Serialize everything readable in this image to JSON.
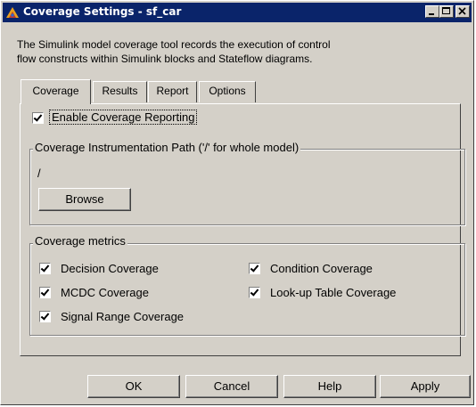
{
  "window": {
    "title": "Coverage Settings - sf_car"
  },
  "description": {
    "line1": "The Simulink model coverage tool records the execution of control",
    "line2": "flow constructs within Simulink blocks and Stateflow diagrams."
  },
  "tabs": [
    {
      "label": "Coverage",
      "active": true
    },
    {
      "label": "Results",
      "active": false
    },
    {
      "label": "Report",
      "active": false
    },
    {
      "label": "Options",
      "active": false
    }
  ],
  "coverage_tab": {
    "enable_label": "Enable Coverage Reporting",
    "enable_checked": true,
    "path_group_title": "Coverage Instrumentation Path ('/' for whole model)",
    "path_value": "/",
    "browse_label": "Browse",
    "metrics_group_title": "Coverage metrics",
    "metrics": [
      {
        "label": "Decision Coverage",
        "checked": true
      },
      {
        "label": "Condition Coverage",
        "checked": true
      },
      {
        "label": "MCDC Coverage",
        "checked": true
      },
      {
        "label": "Look-up Table Coverage",
        "checked": true
      },
      {
        "label": "Signal Range Coverage",
        "checked": true
      }
    ]
  },
  "buttons": {
    "ok": "OK",
    "cancel": "Cancel",
    "help": "Help",
    "apply": "Apply"
  },
  "icons": {
    "app": "stateflow-icon",
    "minimize": "minimize-icon",
    "maximize": "maximize-icon",
    "close": "close-icon"
  },
  "colors": {
    "titlebar": "#0a246a",
    "face": "#d4d0c8"
  }
}
